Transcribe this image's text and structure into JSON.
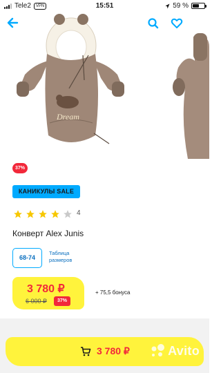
{
  "status": {
    "carrier": "Tele2",
    "vpn": "VPN",
    "time": "15:51",
    "battery": "59 %"
  },
  "header": {
    "back_icon": "arrow-left-icon",
    "search_icon": "search-icon",
    "favorite_icon": "heart-icon"
  },
  "product": {
    "discount_pill": "37%",
    "promo_badge": "КАНИКУЛЫ SALE",
    "rating": 4,
    "rating_max": 5,
    "rating_count": "4",
    "title": "Конверт Alex Junis",
    "size": "68-74",
    "size_table_label": "Таблица размеров",
    "price": "3 780 ₽",
    "old_price": "6 000 ₽",
    "discount": "37%",
    "bonus": "+ 75,5 бонуса",
    "embroidery": "Dream"
  },
  "cart": {
    "price": "3 780 ₽",
    "cart_icon": "cart-icon"
  },
  "watermark": {
    "text": "Avito"
  },
  "colors": {
    "accent_blue": "#00aaff",
    "price_red": "#f2283a",
    "yellow": "#fff33c"
  }
}
